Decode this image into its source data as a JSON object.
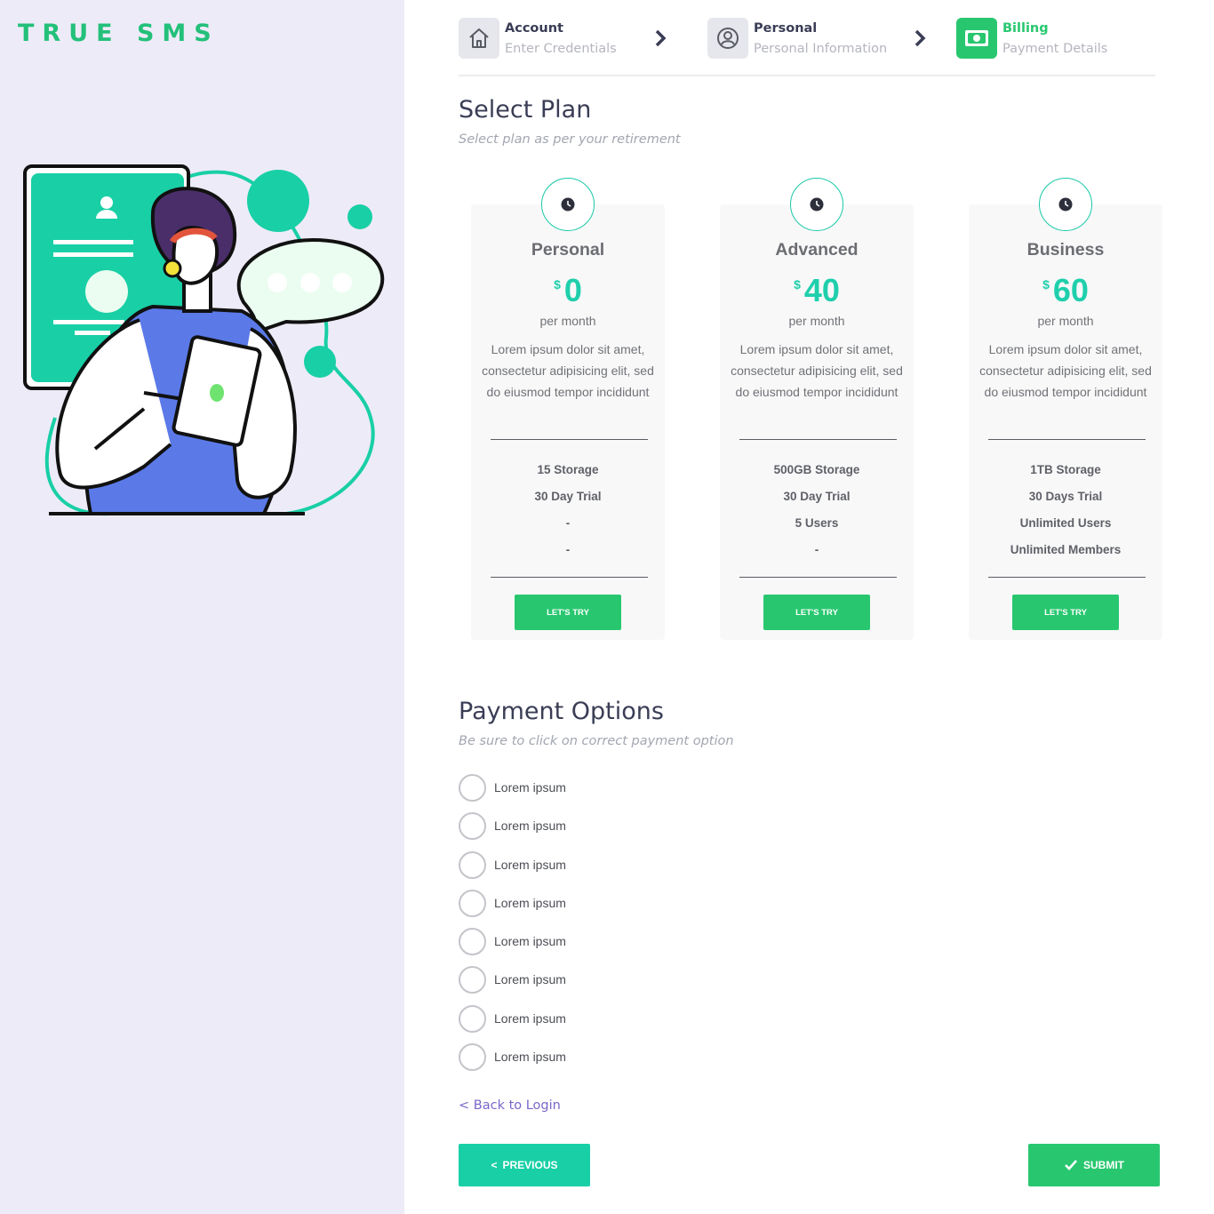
{
  "brand": "TRUE SMS",
  "stepper": {
    "steps": [
      {
        "title": "Account",
        "subtitle": "Enter Credentials",
        "icon": "home-icon"
      },
      {
        "title": "Personal",
        "subtitle": "Personal Information",
        "icon": "user-circle-icon"
      },
      {
        "title": "Billing",
        "subtitle": "Payment Details",
        "icon": "money-bill-icon",
        "active": true
      }
    ]
  },
  "plan_section": {
    "title": "Select Plan",
    "subtitle": "Select plan as per your retirement"
  },
  "plans": [
    {
      "name": "Personal",
      "currency": "$",
      "price": "0",
      "period": "per month",
      "description": "Lorem ipsum dolor sit amet, consectetur adipisicing elit, sed do eiusmod tempor incididunt",
      "features": [
        "15 Storage",
        "30 Day Trial",
        "-",
        "-"
      ],
      "button": "LET'S TRY"
    },
    {
      "name": "Advanced",
      "currency": "$",
      "price": "40",
      "period": "per month",
      "description": "Lorem ipsum dolor sit amet, consectetur adipisicing elit, sed do eiusmod tempor incididunt",
      "features": [
        "500GB Storage",
        "30 Day Trial",
        "5 Users",
        "-"
      ],
      "button": "LET'S TRY"
    },
    {
      "name": "Business",
      "currency": "$",
      "price": "60",
      "period": "per month",
      "description": "Lorem ipsum dolor sit amet, consectetur adipisicing elit, sed do eiusmod tempor incididunt",
      "features": [
        "1TB Storage",
        "30 Days Trial",
        "Unlimited Users",
        "Unlimited Members"
      ],
      "button": "LET'S TRY"
    }
  ],
  "payment_section": {
    "title": "Payment Options",
    "subtitle": "Be sure to click on correct payment option",
    "options": [
      "Lorem ipsum",
      "Lorem ipsum",
      "Lorem ipsum",
      "Lorem ipsum",
      "Lorem ipsum",
      "Lorem ipsum",
      "Lorem ipsum",
      "Lorem ipsum"
    ]
  },
  "back_link": "< Back to Login",
  "buttons": {
    "previous": "PREVIOUS",
    "submit": "SUBMIT"
  },
  "colors": {
    "brand_green": "#23c07a",
    "accent_teal": "#1fcfac",
    "button_green": "#28c76f",
    "left_panel_bg": "#eeebf8",
    "link_purple": "#7b66c9"
  }
}
